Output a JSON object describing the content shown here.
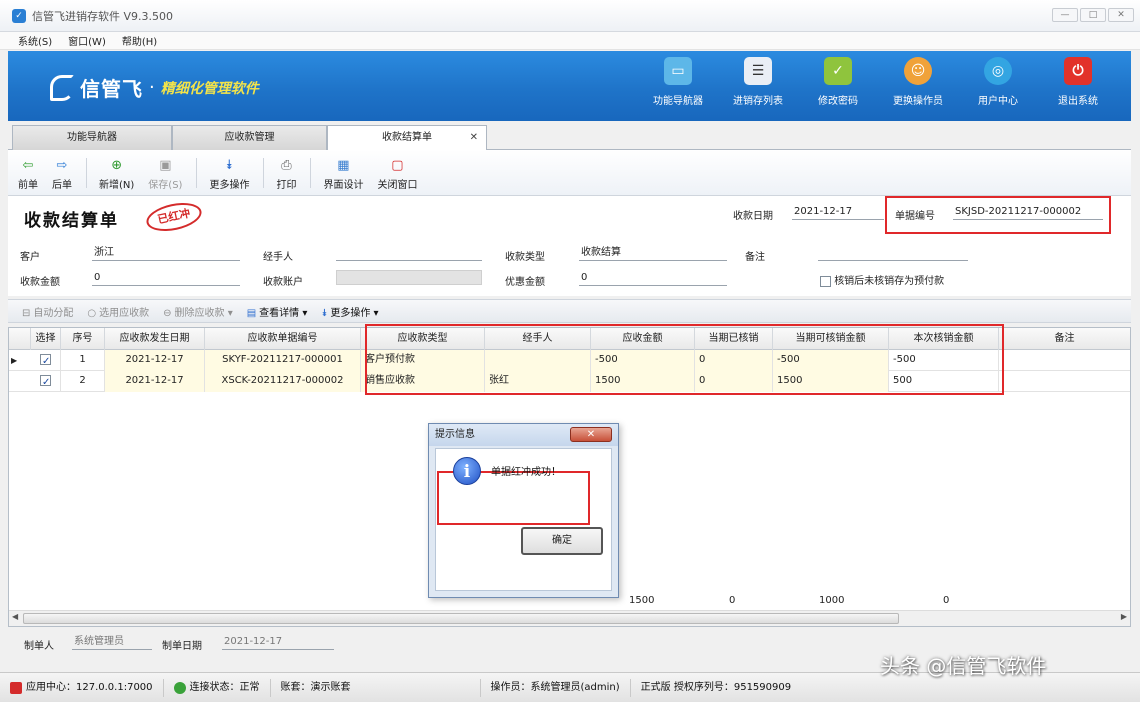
{
  "window": {
    "title": "信管飞进销存软件 V9.3.500",
    "controls": [
      "—",
      "□",
      "✕"
    ]
  },
  "menu": [
    "系统(S)",
    "窗口(W)",
    "帮助(H)"
  ],
  "banner": {
    "logo_name": "信管飞",
    "slogan": "精细化管理软件",
    "tools": [
      {
        "label": "功能导航器",
        "icon": "monitor-icon",
        "color": "#5db7e8"
      },
      {
        "label": "进销存列表",
        "icon": "list-icon",
        "color": "#e9eef5"
      },
      {
        "label": "修改密码",
        "icon": "lock-icon",
        "color": "#8fc43d"
      },
      {
        "label": "更换操作员",
        "icon": "user-icon",
        "color": "#f0a23a"
      },
      {
        "label": "用户中心",
        "icon": "globe-icon",
        "color": "#33a5e2"
      },
      {
        "label": "退出系统",
        "icon": "power-icon",
        "color": "#e2322a"
      }
    ]
  },
  "tabs": [
    "功能导航器",
    "应收款管理",
    "收款结算单"
  ],
  "toolbar": {
    "buttons": [
      "前单",
      "后单",
      "新增(N)",
      "保存(S)",
      "更多操作",
      "打印",
      "界面设计",
      "关闭窗口"
    ]
  },
  "form": {
    "doc_title": "收款结算单",
    "stamp": "已红冲",
    "date_label": "收款日期",
    "date_value": "2021-12-17",
    "docno_label": "单据编号",
    "docno_value": "SKJSD-20211217-000002",
    "customer_label": "客户",
    "customer_value": "浙江",
    "handler_label": "经手人",
    "handler_value": "",
    "type_label": "收款类型",
    "type_value": "收款结算",
    "remark_label": "备注",
    "remark_value": "",
    "amount_label": "收款金额",
    "amount_value": "0",
    "account_label": "收款账户",
    "account_value": "",
    "discount_label": "优惠金额",
    "discount_value": "0",
    "checkbox_label": "核销后未核销存为预付款"
  },
  "grid_toolbar": [
    "自动分配",
    "选用应收款",
    "删除应收款",
    "查看详情",
    "更多操作"
  ],
  "grid": {
    "headers": [
      "选择",
      "序号",
      "应收款发生日期",
      "应收款单据编号",
      "应收款类型",
      "经手人",
      "应收金额",
      "当期已核销",
      "当期可核销金额",
      "本次核销金额",
      "备注"
    ],
    "rows": [
      {
        "no": "1",
        "date": "2021-12-17",
        "docno": "SKYF-20211217-000001",
        "type": "客户预付款",
        "handler": "",
        "amount": "-500",
        "written_off": "0",
        "available": "-500",
        "this_time": "-500",
        "remark": ""
      },
      {
        "no": "2",
        "date": "2021-12-17",
        "docno": "XSCK-20211217-000002",
        "type": "销售应收款",
        "handler": "张红",
        "amount": "1500",
        "written_off": "0",
        "available": "1500",
        "this_time": "500",
        "remark": ""
      }
    ],
    "footer": {
      "amount": "1500",
      "written_off": "0",
      "available": "1000",
      "this_time": "0"
    }
  },
  "bottom": {
    "creator_label": "制单人",
    "creator_value": "系统管理员",
    "create_date_label": "制单日期",
    "create_date_value": "2021-12-17"
  },
  "dialog": {
    "title": "提示信息",
    "message": "单据红冲成功！",
    "ok": "确定",
    "close": "✕"
  },
  "status": {
    "app_center": "应用中心：127.0.0.1:7000",
    "connection": "连接状态：正常",
    "account": "账套：演示账套",
    "operator": "操作员：系统管理员(admin)",
    "license": "正式版  授权序列号：951590909"
  },
  "watermark": "头条 @信管飞软件",
  "colors": {
    "banner": "#1f74c9",
    "highlight_box": "#e0282a",
    "grid_yellow": "#fffbe3"
  }
}
